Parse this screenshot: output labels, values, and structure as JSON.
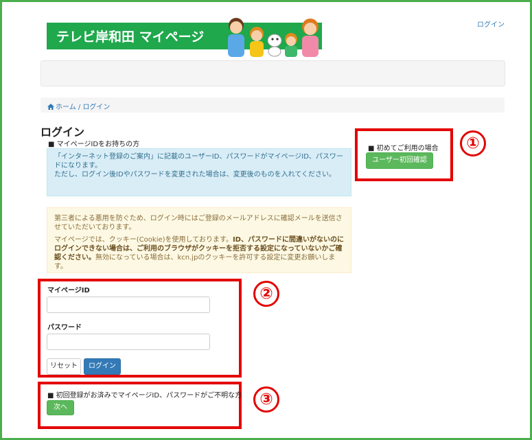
{
  "header": {
    "login_link": "ログイン",
    "banner_title": "テレビ岸和田 マイページ"
  },
  "breadcrumb": {
    "home": "ホーム",
    "separator": " / ",
    "current": "ログイン"
  },
  "page_title": "ログイン",
  "existing": {
    "label": "■ マイページIDをお持ちの方",
    "info_line1": "「インターネット登録のご案内」に記載のユーザーID、パスワードがマイページID、パスワードになります。",
    "info_line2": "ただし、ログイン後IDやパスワードを変更された場合は、変更後のものを入れてください。"
  },
  "warning": {
    "para1": "第三者による悪用を防ぐため、ログイン時にはご登録のメールアドレスに確認メールを送信させていただいております。",
    "para2_prefix": "マイページでは、クッキー(Cookie)を使用しております。",
    "para2_bold": "ID、パスワードに間違いがないのにログインできない場合は、ご利用のブラウザがクッキーを拒否する設定になっていないかご確認ください。",
    "para2_suffix": "無効になっている場合は、kcn.jpのクッキーを許可する設定に変更お願いします。"
  },
  "first_time": {
    "label": "■ 初めてご利用の場合",
    "button": "ユーザー初回確認"
  },
  "form": {
    "id_label": "マイページID",
    "id_value": "",
    "password_label": "パスワード",
    "password_value": "",
    "reset_button": "リセット",
    "login_button": "ログイン"
  },
  "forgot": {
    "label": "■ 初回登録がお済みでマイページID、パスワードがご不明な方",
    "button": "次へ"
  },
  "annotations": {
    "num1": "①",
    "num2": "②",
    "num3": "③"
  },
  "colors": {
    "annotation_red": "#e30000",
    "brand_green": "#1fa84c",
    "primary_blue": "#337ab7"
  }
}
